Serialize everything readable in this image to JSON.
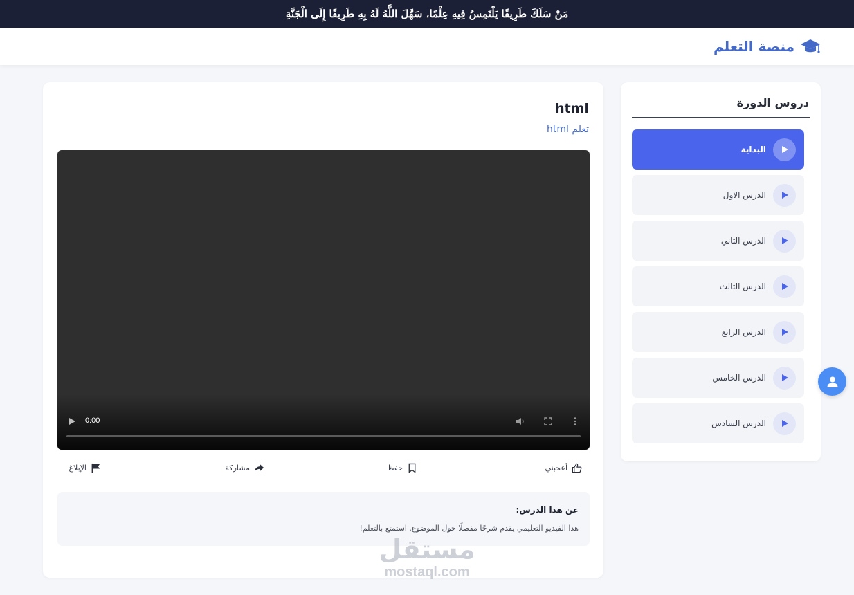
{
  "banner": {
    "text": "مَنْ سَلَكَ طَرِيقًا يَلْتَمِسُ فِيهِ عِلْمًا، سَهَّلَ اللَّهُ لَهُ بِهِ طَرِيقًا إِلَى الْجَنَّةِ"
  },
  "header": {
    "brand": "منصة التعلم",
    "brand_icon": "graduation-cap-icon"
  },
  "sidebar": {
    "title": "دروس الدورة",
    "lessons": [
      {
        "label": "البداية",
        "active": true
      },
      {
        "label": "الدرس الاول",
        "active": false
      },
      {
        "label": "الدرس الثاني",
        "active": false
      },
      {
        "label": "الدرس الثالث",
        "active": false
      },
      {
        "label": "الدرس الرابع",
        "active": false
      },
      {
        "label": "الدرس الخامس",
        "active": false
      },
      {
        "label": "الدرس السادس",
        "active": false
      }
    ]
  },
  "main": {
    "title": "html",
    "subtitle": "تعلم html",
    "video": {
      "time": "0:00",
      "progress": 0
    },
    "actions": {
      "like": "أعجبني",
      "save": "حفظ",
      "share": "مشاركة",
      "report": "الإبلاغ"
    },
    "about": {
      "title": "عن هذا الدرس:",
      "text": "هذا الفيديو التعليمي يقدم شرحًا مفصلًا حول الموضوع. استمتع بالتعلم!"
    }
  },
  "watermark": {
    "arabic": "مستقل",
    "latin": "mostaql.com"
  },
  "colors": {
    "accent": "#4a65ec",
    "brand": "#4569c9",
    "topbar": "#1c2036",
    "fab": "#4a8ef5"
  }
}
